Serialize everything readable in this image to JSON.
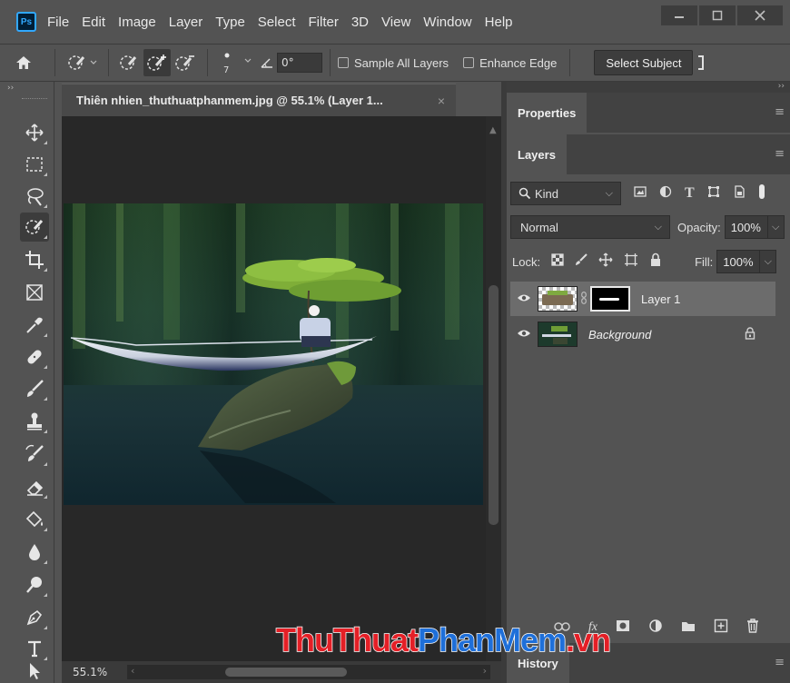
{
  "app": {
    "logo": "Ps",
    "menu": [
      "File",
      "Edit",
      "Image",
      "Layer",
      "Type",
      "Select",
      "Filter",
      "3D",
      "View",
      "Window",
      "Help"
    ]
  },
  "options_bar": {
    "brush_size": "7",
    "angle_value": "0°",
    "sample_all_layers": "Sample All Layers",
    "enhance_edge": "Enhance Edge",
    "select_subject": "Select Subject"
  },
  "document": {
    "tab_title": "Thiên nhien_thuthuatphanmem.jpg @ 55.1% (Layer 1...",
    "close_glyph": "×",
    "zoom": "55.1%"
  },
  "panels": {
    "properties_tab": "Properties",
    "layers_tab": "Layers",
    "history_tab": "History",
    "collapse_glyph": "››"
  },
  "layers": {
    "filter_kind": "Kind",
    "blend_mode": "Normal",
    "opacity_label": "Opacity:",
    "opacity_value": "100%",
    "lock_label": "Lock:",
    "fill_label": "Fill:",
    "fill_value": "100%",
    "items": [
      {
        "name": "Layer 1",
        "visible": true,
        "selected": true,
        "has_mask": true
      },
      {
        "name": "Background",
        "visible": true,
        "selected": false,
        "locked": true
      }
    ]
  },
  "watermark": {
    "part_a": "ThuThuat",
    "part_b": "PhanMem",
    "part_c": ".vn"
  },
  "colors": {
    "ui_bg": "#535353",
    "canvas_bg": "#282828",
    "ps_blue": "#31a8ff",
    "watermark_red": "#e41f26",
    "watermark_blue": "#1e6fd9"
  }
}
